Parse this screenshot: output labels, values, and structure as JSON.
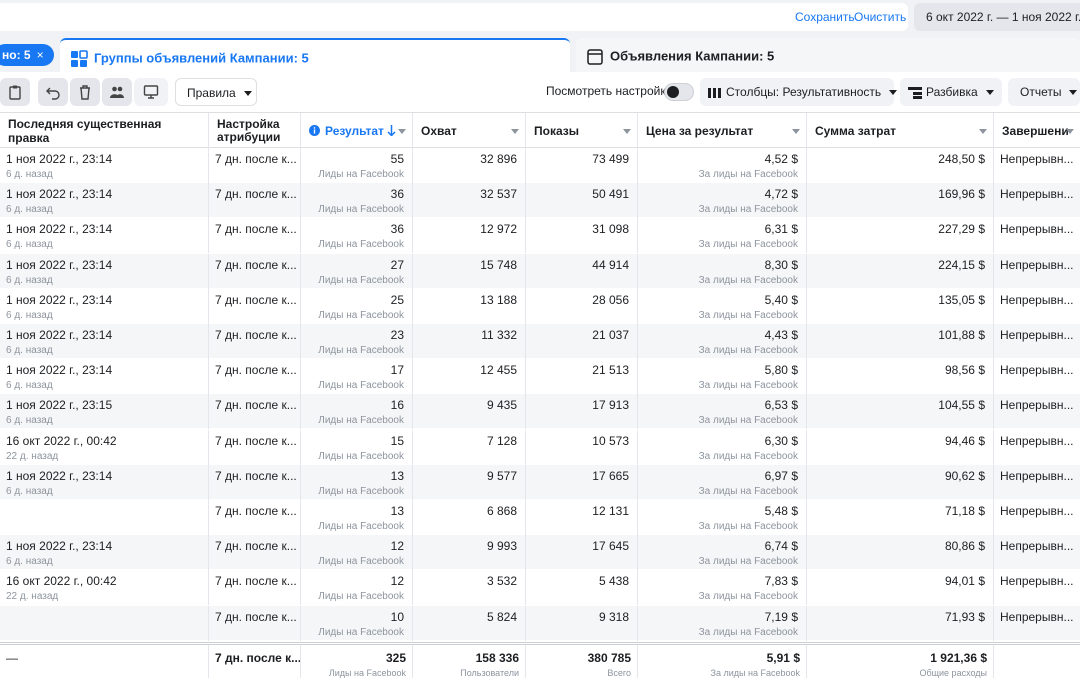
{
  "top": {
    "save": "Сохранить",
    "clear": "Очистить",
    "date_range": "6 окт 2022 г. — 1 ноя 2022 г."
  },
  "tabs": {
    "chip_label": "но: 5",
    "chip_close": "×",
    "adsets": "Группы объявлений Кампании: 5",
    "ads": "Объявления Кампании: 5"
  },
  "toolbar": {
    "rules": "Правила",
    "view_settings": "Посмотреть настройки",
    "columns": "Столбцы: Результативность",
    "breakdown": "Разбивка",
    "reports": "Отчеты"
  },
  "columns": {
    "last_edit": "Последняя существенная правка",
    "attribution_l1": "Настройка",
    "attribution_l2": "атрибуции",
    "results": "Результат",
    "reach": "Охват",
    "impressions": "Показы",
    "cpr": "Цена за результат",
    "spend": "Сумма затрат",
    "end": "Завершени"
  },
  "rows": [
    {
      "edit": "1 ноя 2022 г., 23:14",
      "ago": "6 д. назад",
      "attr": "7 дн. после к...",
      "res": "55",
      "res_sub": "Лиды на Facebook",
      "reach": "32 896",
      "impr": "73 499",
      "cpr": "4,52 $",
      "cpr_sub": "За лиды на Facebook",
      "spend": "248,50 $",
      "end": "Непрерывн..."
    },
    {
      "edit": "1 ноя 2022 г., 23:14",
      "ago": "6 д. назад",
      "attr": "7 дн. после к...",
      "res": "36",
      "res_sub": "Лиды на Facebook",
      "reach": "32 537",
      "impr": "50 491",
      "cpr": "4,72 $",
      "cpr_sub": "За лиды на Facebook",
      "spend": "169,96 $",
      "end": "Непрерывн..."
    },
    {
      "edit": "1 ноя 2022 г., 23:14",
      "ago": "6 д. назад",
      "attr": "7 дн. после к...",
      "res": "36",
      "res_sub": "Лиды на Facebook",
      "reach": "12 972",
      "impr": "31 098",
      "cpr": "6,31 $",
      "cpr_sub": "За лиды на Facebook",
      "spend": "227,29 $",
      "end": "Непрерывн..."
    },
    {
      "edit": "1 ноя 2022 г., 23:14",
      "ago": "6 д. назад",
      "attr": "7 дн. после к...",
      "res": "27",
      "res_sub": "Лиды на Facebook",
      "reach": "15 748",
      "impr": "44 914",
      "cpr": "8,30 $",
      "cpr_sub": "За лиды на Facebook",
      "spend": "224,15 $",
      "end": "Непрерывн..."
    },
    {
      "edit": "1 ноя 2022 г., 23:14",
      "ago": "6 д. назад",
      "attr": "7 дн. после к...",
      "res": "25",
      "res_sub": "Лиды на Facebook",
      "reach": "13 188",
      "impr": "28 056",
      "cpr": "5,40 $",
      "cpr_sub": "За лиды на Facebook",
      "spend": "135,05 $",
      "end": "Непрерывн..."
    },
    {
      "edit": "1 ноя 2022 г., 23:14",
      "ago": "6 д. назад",
      "attr": "7 дн. после к...",
      "res": "23",
      "res_sub": "Лиды на Facebook",
      "reach": "11 332",
      "impr": "21 037",
      "cpr": "4,43 $",
      "cpr_sub": "За лиды на Facebook",
      "spend": "101,88 $",
      "end": "Непрерывн..."
    },
    {
      "edit": "1 ноя 2022 г., 23:14",
      "ago": "6 д. назад",
      "attr": "7 дн. после к...",
      "res": "17",
      "res_sub": "Лиды на Facebook",
      "reach": "12 455",
      "impr": "21 513",
      "cpr": "5,80 $",
      "cpr_sub": "За лиды на Facebook",
      "spend": "98,56 $",
      "end": "Непрерывн..."
    },
    {
      "edit": "1 ноя 2022 г., 23:15",
      "ago": "6 д. назад",
      "attr": "7 дн. после к...",
      "res": "16",
      "res_sub": "Лиды на Facebook",
      "reach": "9 435",
      "impr": "17 913",
      "cpr": "6,53 $",
      "cpr_sub": "За лиды на Facebook",
      "spend": "104,55 $",
      "end": "Непрерывн..."
    },
    {
      "edit": "16 окт 2022 г., 00:42",
      "ago": "22 д. назад",
      "attr": "7 дн. после к...",
      "res": "15",
      "res_sub": "Лиды на Facebook",
      "reach": "7 128",
      "impr": "10 573",
      "cpr": "6,30 $",
      "cpr_sub": "За лиды на Facebook",
      "spend": "94,46 $",
      "end": "Непрерывн..."
    },
    {
      "edit": "1 ноя 2022 г., 23:14",
      "ago": "6 д. назад",
      "attr": "7 дн. после к...",
      "res": "13",
      "res_sub": "Лиды на Facebook",
      "reach": "9 577",
      "impr": "17 665",
      "cpr": "6,97 $",
      "cpr_sub": "За лиды на Facebook",
      "spend": "90,62 $",
      "end": "Непрерывн..."
    },
    {
      "edit": "",
      "ago": "",
      "attr": "7 дн. после к...",
      "res": "13",
      "res_sub": "Лиды на Facebook",
      "reach": "6 868",
      "impr": "12 131",
      "cpr": "5,48 $",
      "cpr_sub": "За лиды на Facebook",
      "spend": "71,18 $",
      "end": "Непрерывн..."
    },
    {
      "edit": "1 ноя 2022 г., 23:14",
      "ago": "6 д. назад",
      "attr": "7 дн. после к...",
      "res": "12",
      "res_sub": "Лиды на Facebook",
      "reach": "9 993",
      "impr": "17 645",
      "cpr": "6,74 $",
      "cpr_sub": "За лиды на Facebook",
      "spend": "80,86 $",
      "end": "Непрерывн..."
    },
    {
      "edit": "16 окт 2022 г., 00:42",
      "ago": "22 д. назад",
      "attr": "7 дн. после к...",
      "res": "12",
      "res_sub": "Лиды на Facebook",
      "reach": "3 532",
      "impr": "5 438",
      "cpr": "7,83 $",
      "cpr_sub": "За лиды на Facebook",
      "spend": "94,01 $",
      "end": "Непрерывн..."
    },
    {
      "edit": "",
      "ago": "",
      "attr": "7 дн. после к...",
      "res": "10",
      "res_sub": "Лиды на Facebook",
      "reach": "5 824",
      "impr": "9 318",
      "cpr": "7,19 $",
      "cpr_sub": "За лиды на Facebook",
      "spend": "71,93 $",
      "end": "Непрерывн..."
    }
  ],
  "totals": {
    "edit": "—",
    "attr": "7 дн. после к...",
    "res": "325",
    "res_sub": "Лиды на Facebook",
    "reach": "158 336",
    "reach_sub": "Пользователи",
    "impr": "380 785",
    "impr_sub": "Всего",
    "cpr": "5,91 $",
    "cpr_sub": "За лиды на Facebook",
    "spend": "1 921,36 $",
    "spend_sub": "Общие расходы"
  },
  "colors": {
    "accent": "#1877f2",
    "row_alt": "#f5f6f7",
    "muted": "#8d949e"
  }
}
